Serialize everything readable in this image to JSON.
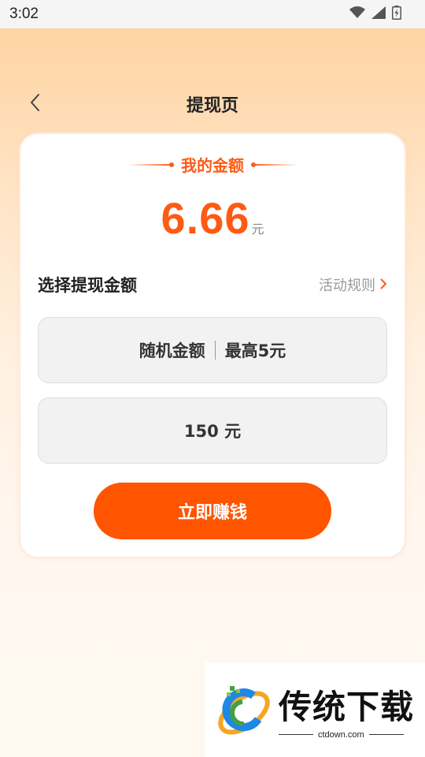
{
  "status_bar": {
    "time": "3:02"
  },
  "header": {
    "title": "提现页"
  },
  "balance": {
    "label": "我的金额",
    "amount": "6.66",
    "unit": "元"
  },
  "withdraw": {
    "section_title": "选择提现金额",
    "rules_link": "活动规则",
    "options": [
      {
        "left": "随机金额",
        "right": "最高5元"
      },
      {
        "label": "150 元"
      }
    ]
  },
  "cta": {
    "label": "立即赚钱"
  },
  "watermark": {
    "title": "传统下载",
    "domain": "ctdown.com"
  },
  "colors": {
    "accent": "#ff5400",
    "amount_text": "#ff5a14"
  },
  "icons": [
    "wifi-icon",
    "signal-icon",
    "battery-icon",
    "back-chevron-icon",
    "chevron-right-icon",
    "ctdown-logo"
  ]
}
